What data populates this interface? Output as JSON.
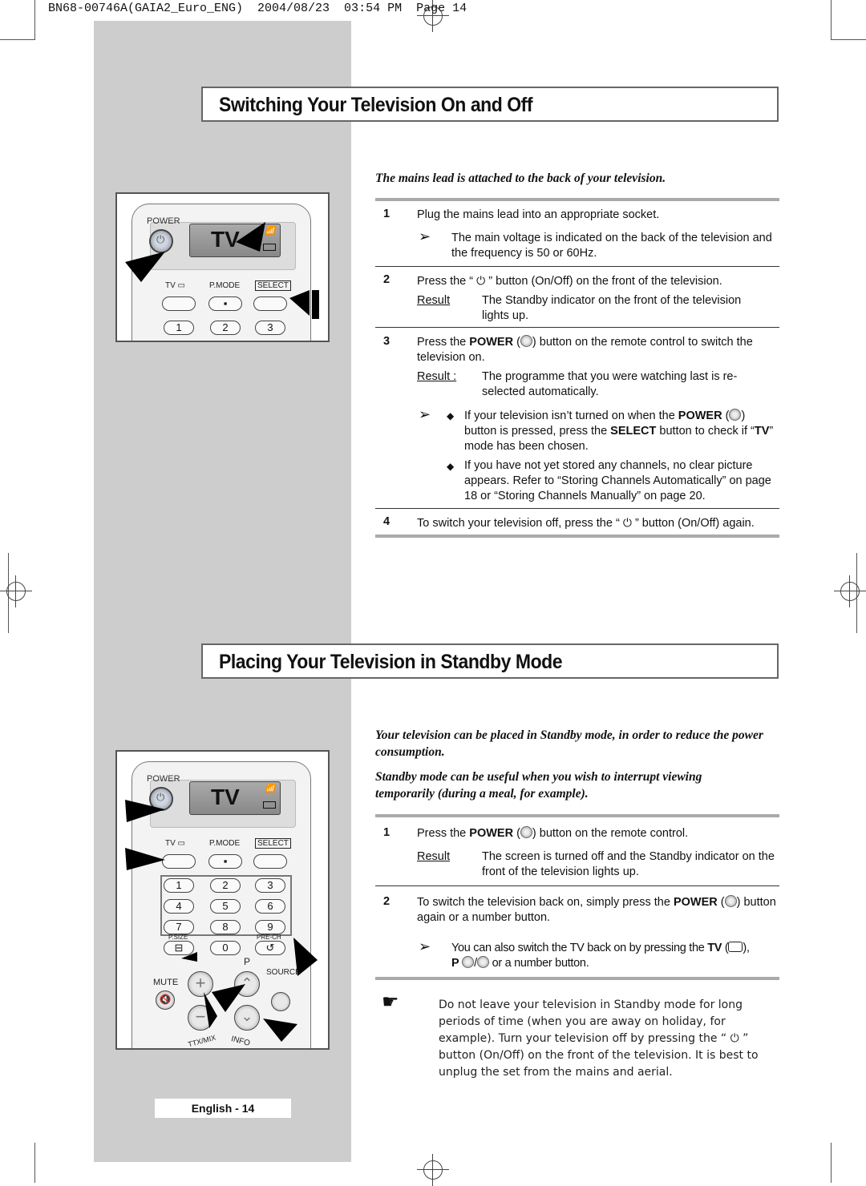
{
  "print_header": "BN68-00746A(GAIA2_Euro_ENG)  2004/08/23  03:54 PM  Page 14",
  "section1": {
    "title": "Switching Your Television On and Off",
    "intro": "The mains lead is attached to the back of your television.",
    "steps": [
      {
        "num": "1",
        "text": "Plug the mains lead into an appropriate socket.",
        "note": "The main voltage is indicated on the back of the television and the frequency is 50 or 60Hz."
      },
      {
        "num": "2",
        "text_a": "Press the “",
        "text_b": "” button (On/Off) on the front of the television.",
        "result_label": "Result",
        "result": "The Standby indicator on the front of the television lights up."
      },
      {
        "num": "3",
        "text_a": "Press the ",
        "bold": "POWER",
        "text_b": ") button on the remote control to switch the television on.",
        "result_label": "Result :",
        "result": "The programme that you were watching last is re-selected automatically.",
        "bullets": [
          {
            "a": "If your television isn’t turned on when the ",
            "b1": "POWER",
            "c": ") button is pressed, press the ",
            "b2": "SELECT",
            "d": " button to check if “",
            "b3": "TV",
            "e": "” mode has been chosen."
          },
          {
            "a": "If you have not yet stored any channels, no clear picture appears. Refer to “Storing Channels Automatically” on page 18 or “Storing Channels Manually” on page 20."
          }
        ]
      },
      {
        "num": "4",
        "text_a": "To switch your television off, press the “",
        "text_b": "” button (On/Off) again."
      }
    ]
  },
  "section2": {
    "title": "Placing Your Television in Standby Mode",
    "intro1": "Your television can be placed in Standby mode, in order to reduce the power consumption.",
    "intro2": "Standby mode can be useful when you wish to interrupt viewing temporarily (during a meal, for example).",
    "steps": [
      {
        "num": "1",
        "text_a": "Press the ",
        "bold": "POWER",
        "text_b": ") button on the remote control.",
        "result_label": "Result",
        "result": "The screen is turned off and the Standby indicator on the front of the television lights up."
      },
      {
        "num": "2",
        "text_a": "To switch the television back on, simply press the ",
        "bold": "POWER",
        "text_b": ") button again or a number button.",
        "note_a": "You can also switch  the TV back on by pressing the ",
        "note_b1": "TV",
        "note_c": "),",
        "note_b2": "P",
        "note_d": " or a number button."
      }
    ],
    "warning_a": "Do not leave your television in Standby mode for long periods of time (when you are away on holiday, for example). Turn your television off by pressing the “",
    "warning_b": "” button (On/Off) on the front of the television. It is best to unplug the set from the mains and aerial."
  },
  "remote": {
    "power": "POWER",
    "display": "TV",
    "tv": "TV",
    "pmode": "P.MODE",
    "select": "SELECT",
    "digits": [
      "1",
      "2",
      "3",
      "4",
      "5",
      "6",
      "7",
      "8",
      "9",
      "0"
    ],
    "psize": "P.SIZE",
    "prech": "PRE-CH",
    "p": "P",
    "mute": "MUTE",
    "source": "SOURCE",
    "ttx": "TTX/MIX",
    "info": "INFO"
  },
  "footer": "English - 14"
}
